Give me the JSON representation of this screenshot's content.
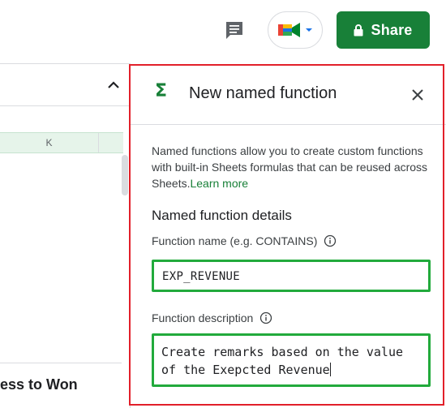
{
  "toolbar": {
    "comments_icon": "comment-icon",
    "meet_icon": "google-meet-icon",
    "share_label": "Share",
    "share_icon": "lock-icon"
  },
  "sheet": {
    "column_header": "K",
    "visible_cell_text": "ess to Won"
  },
  "panel": {
    "title": "New named function",
    "icon": "sigma-icon",
    "description": "Named functions allow you to create custom functions with built-in Sheets formulas that can be reused across Sheets.",
    "learn_more": "Learn more",
    "section_heading": "Named function details",
    "name_label": "Function name (e.g. CONTAINS)",
    "name_value": "EXP_REVENUE",
    "desc_label": "Function description",
    "desc_value": "Create remarks based on the value of the Exepcted Revenue"
  },
  "colors": {
    "accent_green": "#188038",
    "highlight_green": "#22aa3c",
    "highlight_red": "#e2202a"
  }
}
